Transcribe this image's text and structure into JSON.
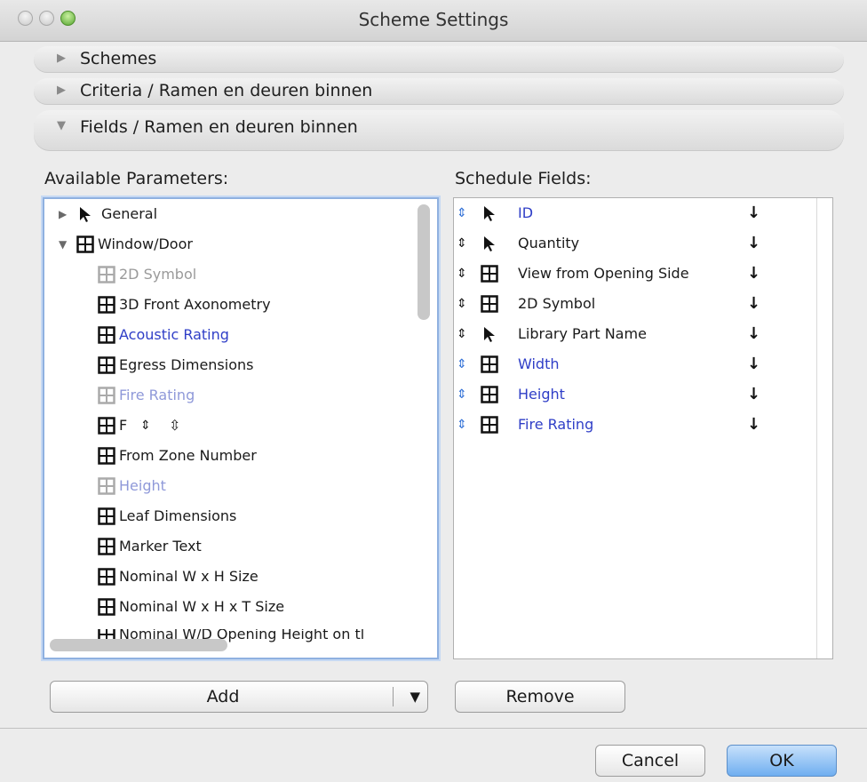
{
  "window": {
    "title": "Scheme Settings"
  },
  "sections": {
    "schemes": "Schemes",
    "criteria": "Criteria /  Ramen en deuren binnen",
    "fields": "Fields /  Ramen en deuren binnen"
  },
  "available": {
    "heading": "Available Parameters:",
    "groups": [
      "General",
      "Window/Door"
    ],
    "items": [
      "2D Symbol",
      "3D Front Axonometry",
      "Acoustic Rating",
      "Egress Dimensions",
      "Fire Rating",
      "F",
      "From Zone Number",
      "Height",
      "Leaf Dimensions",
      "Marker Text",
      "Nominal W x H Size",
      "Nominal W x H x T Size",
      "Nominal W/D Opening Height on tl"
    ]
  },
  "schedule": {
    "heading": "Schedule Fields:",
    "items": [
      {
        "label": "ID",
        "icon": "arrow-icon"
      },
      {
        "label": "Quantity",
        "icon": "arrow-icon"
      },
      {
        "label": "View from Opening Side",
        "icon": "grid-icon"
      },
      {
        "label": "2D Symbol",
        "icon": "grid-icon"
      },
      {
        "label": "Library Part Name",
        "icon": "arrow-icon"
      },
      {
        "label": "Width",
        "icon": "grid-icon"
      },
      {
        "label": "Height",
        "icon": "grid-icon"
      },
      {
        "label": "Fire Rating",
        "icon": "grid-icon"
      }
    ]
  },
  "buttons": {
    "add": "Add",
    "remove": "Remove",
    "cancel": "Cancel",
    "ok": "OK"
  }
}
